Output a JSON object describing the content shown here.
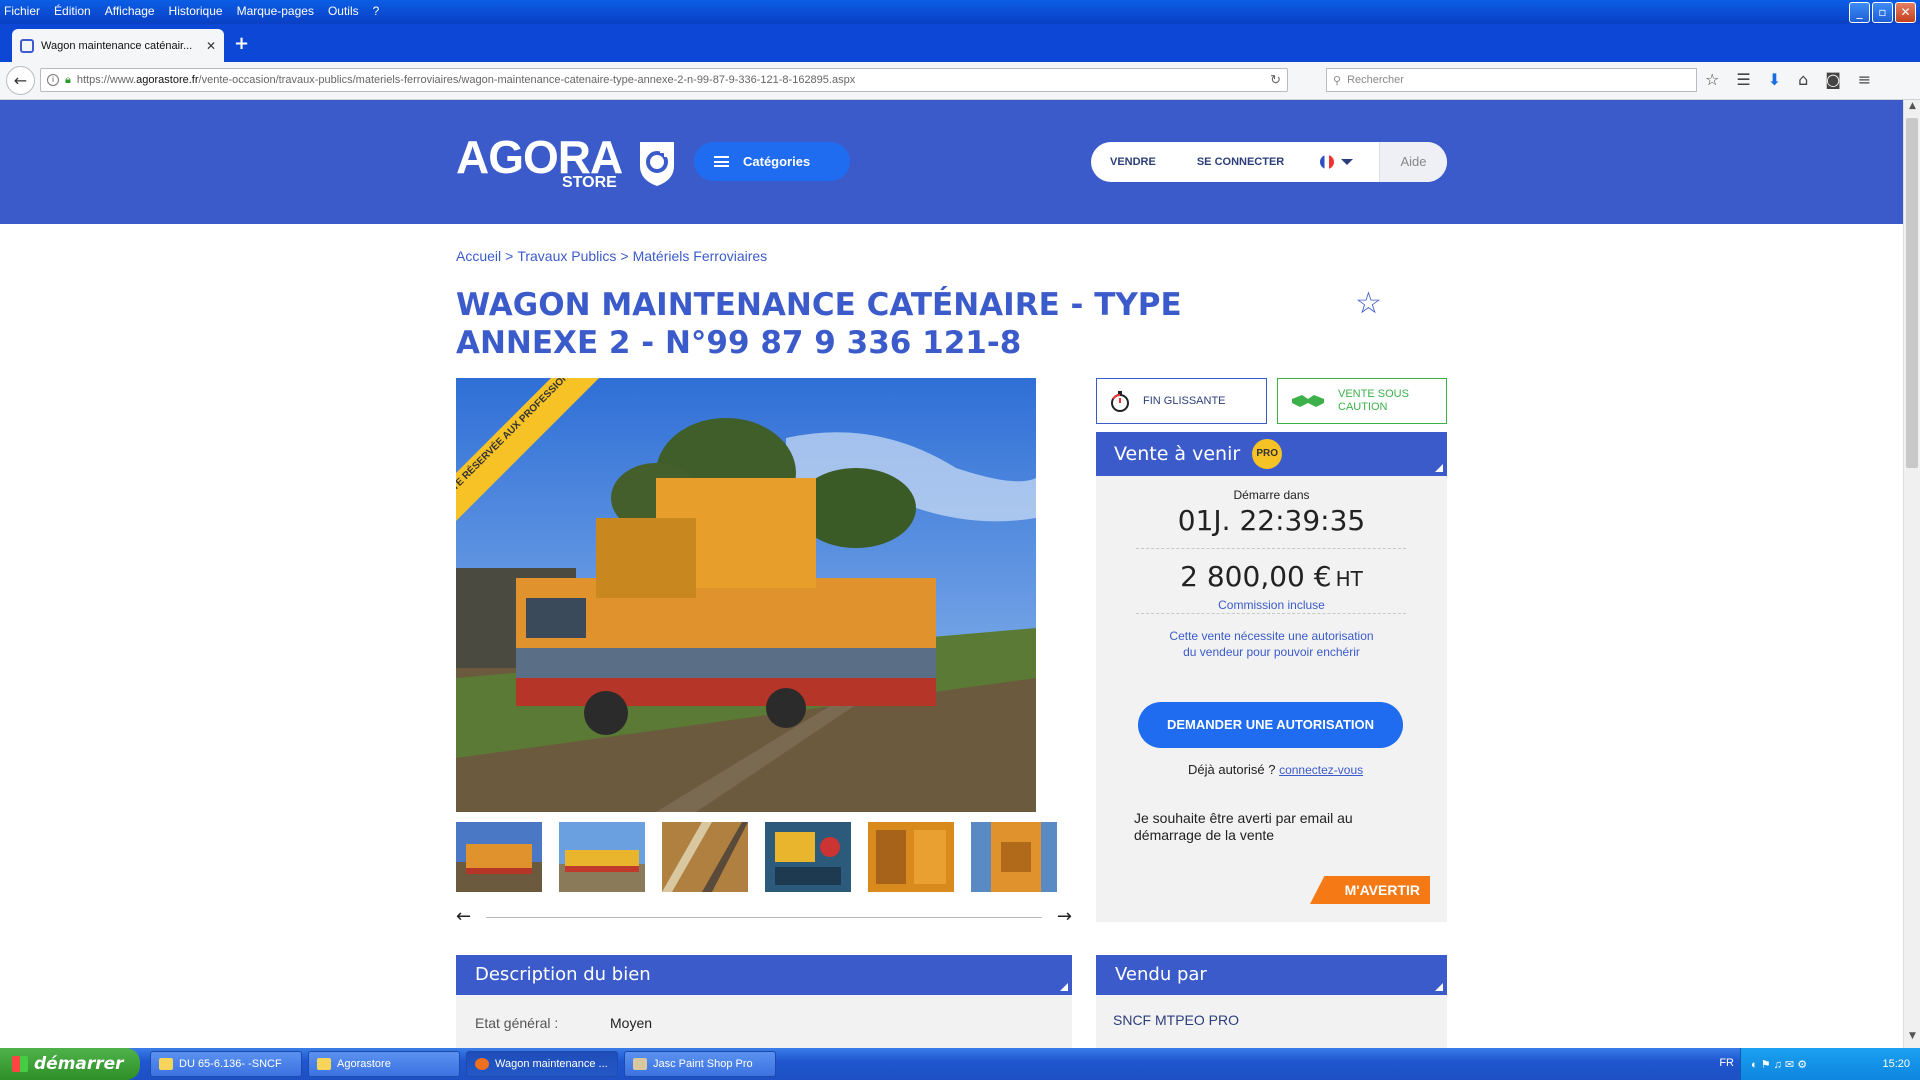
{
  "window": {
    "menu": [
      "Fichier",
      "Édition",
      "Affichage",
      "Historique",
      "Marque-pages",
      "Outils",
      "?"
    ],
    "controls": {
      "minimize": "_",
      "maximize": "▫",
      "close": "✕"
    }
  },
  "browser": {
    "tab_title": "Wagon maintenance caténair...",
    "tab_close": "✕",
    "new_tab": "+",
    "url_prefix": "https://www.",
    "url_domain": "agorastore.fr",
    "url_path": "/vente-occasion/travaux-publics/materiels-ferroviaires/wagon-maintenance-catenaire-type-annexe-2-n-99-87-9-336-121-8-162895.aspx",
    "search_placeholder": "Rechercher",
    "icons": [
      "star-icon",
      "reading-list-icon",
      "download-icon",
      "home-icon",
      "pocket-icon",
      "menu-icon"
    ]
  },
  "site": {
    "logo_main": "AGORA",
    "logo_sub": "STORE",
    "categories_label": "Catégories",
    "nav": {
      "sell": "VENDRE",
      "login": "SE CONNECTER",
      "help": "Aide"
    }
  },
  "breadcrumb": [
    {
      "label": "Accueil"
    },
    {
      "label": "Travaux Publics"
    },
    {
      "label": "Matériels Ferroviaires"
    }
  ],
  "breadcrumb_sep": ">",
  "product": {
    "title": "WAGON MAINTENANCE CATÉNAIRE - TYPE ANNEXE 2 - N°99 87 9 336 121-8",
    "ribbon": "VENTE RÉSERVÉE AUX PROFESSIONNELS",
    "thumbnails_count": 6
  },
  "badges": {
    "fin_glissante": "FIN GLISSANTE",
    "caution": "VENTE SOUS CAUTION"
  },
  "sale_panel": {
    "title": "Vente à venir",
    "pro_badge": "PRO",
    "starts_in_label": "Démarre dans",
    "countdown": "01J. 22:39:35",
    "price": "2 800,00 €",
    "price_suffix": "HT",
    "commission": "Commission incluse",
    "notice": "Cette vente nécessite une autorisation du vendeur pour pouvoir enchérir",
    "request_button": "DEMANDER UNE AUTORISATION",
    "already_label": "Déjà autorisé ?",
    "login_link": "connectez-vous",
    "alert_text": "Je souhaite être averti par email au démarrage de la vente",
    "alert_button": "M'AVERTIR"
  },
  "description": {
    "title": "Description du bien",
    "rows": [
      {
        "key": "Etat général :",
        "value": "Moyen"
      }
    ]
  },
  "seller": {
    "title": "Vendu par",
    "name": "SNCF MTPEO PRO"
  },
  "taskbar": {
    "start": "démarrer",
    "tasks": [
      "DU 65-6.136- -SNCF",
      "Agorastore",
      "Wagon maintenance ...",
      "Jasc Paint Shop Pro"
    ],
    "lang": "FR",
    "clock": "15:20"
  },
  "colors": {
    "brand_blue": "#3b5bcb",
    "button_blue": "#1f6cf0",
    "pro_yellow": "#f7c226",
    "alert_orange": "#f57a16",
    "caution_green": "#3cb14a"
  }
}
